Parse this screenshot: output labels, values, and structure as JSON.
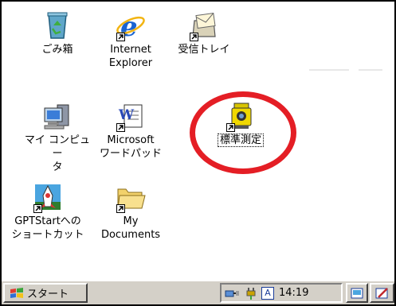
{
  "desktop": {
    "icons": [
      {
        "label": "ごみ箱",
        "icon": "recycle-bin-icon"
      },
      {
        "label": "Internet\nExplorer",
        "icon": "internet-explorer-icon"
      },
      {
        "label": "受信トレイ",
        "icon": "inbox-icon"
      },
      {
        "label": "マイ コンピュー\nタ",
        "icon": "my-computer-icon"
      },
      {
        "label": "Microsoft\nワードパッド",
        "icon": "wordpad-icon"
      },
      {
        "label": "標準測定",
        "icon": "total-station-icon"
      },
      {
        "label": "GPTStartへの\nショートカット",
        "icon": "gptstart-icon"
      },
      {
        "label": "My\nDocuments",
        "icon": "folder-icon"
      }
    ]
  },
  "taskbar": {
    "start_label": "スタート",
    "clock": "14:19",
    "tray_letter": "A"
  },
  "colors": {
    "highlight": "#e41e25",
    "taskbar": "#d4d0c8"
  }
}
